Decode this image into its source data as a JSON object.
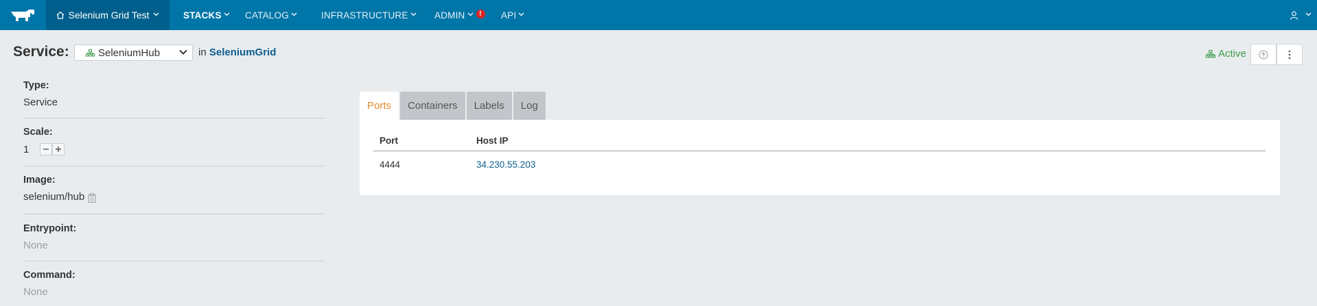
{
  "nav": {
    "environment": "Selenium Grid Test",
    "items": [
      {
        "label": "STACKS",
        "active": true
      },
      {
        "label": "CATALOG",
        "active": false
      },
      {
        "label": "INFRASTRUCTURE",
        "active": false
      },
      {
        "label": "ADMIN",
        "active": false,
        "alert": "!"
      },
      {
        "label": "API",
        "active": false
      }
    ],
    "colors": {
      "bar": "#0075a8",
      "env_bg": "#005f8c",
      "alert": "#d92929"
    }
  },
  "header": {
    "label": "Service:",
    "service_name": "SeleniumHub",
    "in_text": "in",
    "stack_name": "SeleniumGrid",
    "status": "Active",
    "status_color": "#3d9a4a"
  },
  "details": {
    "type": {
      "label": "Type:",
      "value": "Service"
    },
    "scale": {
      "label": "Scale:",
      "value": "1"
    },
    "image": {
      "label": "Image:",
      "value": "selenium/hub"
    },
    "entrypoint": {
      "label": "Entrypoint:",
      "value": "None"
    },
    "command": {
      "label": "Command:",
      "value": "None"
    }
  },
  "tabs": [
    {
      "label": "Ports",
      "active": true
    },
    {
      "label": "Containers",
      "active": false
    },
    {
      "label": "Labels",
      "active": false
    },
    {
      "label": "Log",
      "active": false
    }
  ],
  "ports_table": {
    "columns": [
      "Port",
      "Host IP"
    ],
    "rows": [
      {
        "port": "4444",
        "host_ip": "34.230.55.203"
      }
    ]
  }
}
